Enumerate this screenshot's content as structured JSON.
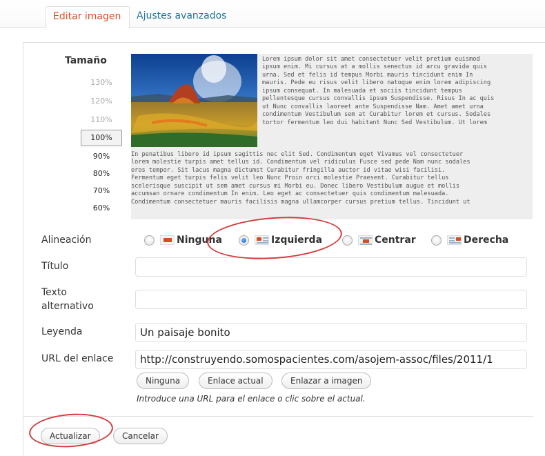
{
  "tabs": [
    {
      "label": "Editar imagen",
      "active": true
    },
    {
      "label": "Ajustes avanzados",
      "active": false
    }
  ],
  "size": {
    "label": "Tamaño",
    "options": [
      "130%",
      "120%",
      "110%",
      "100%",
      "90%",
      "80%",
      "70%",
      "60%"
    ],
    "selected": "100%"
  },
  "preview": {
    "image": "landscape-geyser-image",
    "text_right": [
      "Lorem ipsum dolor sit amet consectetuer velit pretium euismod",
      "ipsum enim. Mi cursus at a mollis senectus id arcu gravida quis",
      "urna. Sed et felis id tempus Morbi mauris tincidunt enim In",
      "mauris. Pede eu risus velit libero natoque enim lorem adipiscing",
      "ipsum consequat. In malesuada et sociis tincidunt tempus",
      "pellentesque cursus convallis ipsum Suspendisse. Risus In ac quis",
      "ut Nunc convallis laoreet ante Suspendisse Nam. Amet amet urna",
      "condimentum Vestibulum sem at Curabitur lorem et cursus. Sodales",
      "tortor fermentum leo dui habitant Nunc Sed Vestibulum. Ut lorem"
    ],
    "text_bottom": [
      "In penatibus libero id ipsum sagittis nec elit Sed. Condimentum eget Vivamus vel consectetuer",
      "lorem molestie turpis amet tellus id. Condimentum vel ridiculus Fusce sed pede Nam nunc sodales",
      "eros tempor. Sit lacus magna dictumst Curabitur fringilla auctor id vitae wisi facilisi.",
      "Fermentum eget turpis felis velit leo Nunc Proin orci molestie Praesent. Curabitur tellus",
      "scelerisque suscipit ut sem amet cursus mi Morbi eu. Donec libero Vestibulum augue et mollis",
      "accumsan ornare condimentum In enim. Leo eget ac consectetuer quis condimentum malesuada.",
      "Condimentum consectetuer mauris facilisis magna ullamcorper cursus pretium tellus. Tincidunt ut"
    ]
  },
  "alignment": {
    "label": "Alineación",
    "options": [
      "Ninguna",
      "Izquierda",
      "Centrar",
      "Derecha"
    ],
    "selected": "Izquierda"
  },
  "fields": {
    "title_label": "Título",
    "title_value": "",
    "alt_label": "Texto alternativo",
    "alt_value": "",
    "caption_label": "Leyenda",
    "caption_value": "Un paisaje bonito",
    "url_label": "URL del enlace",
    "url_value": "http://construyendo.somospacientes.com/asojem-assoc/files/2011/1"
  },
  "link_buttons": [
    "Ninguna",
    "Enlace actual",
    "Enlazar a imagen"
  ],
  "link_hint": "Introduce una URL para el enlace o clic sobre el actual.",
  "actions": {
    "update": "Actualizar",
    "cancel": "Cancelar"
  },
  "colors": {
    "active_tab": "#d54e21",
    "link": "#21759b",
    "annotation": "#d43c3c"
  }
}
